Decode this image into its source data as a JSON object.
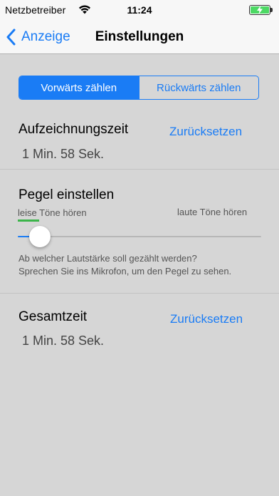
{
  "status": {
    "carrier": "Netzbetreiber",
    "time": "11:24",
    "battery_color": "#4cd964",
    "wifi_icon": "wifi-icon",
    "battery_icon": "battery-charging-icon"
  },
  "nav": {
    "back_label": "Anzeige",
    "title": "Einstellungen",
    "back_icon": "chevron-left-icon"
  },
  "colors": {
    "accent": "#1a7cf5",
    "level_indicator": "#3cb54a",
    "background": "#d6d6d6"
  },
  "segment": {
    "options": [
      "Vorwärts zählen",
      "Rückwärts zählen"
    ],
    "selected": "Vorwärts zählen"
  },
  "recording": {
    "title": "Aufzeichnungszeit",
    "reset_label": "Zurücksetzen",
    "value": "1 Min. 58 Sek."
  },
  "level": {
    "title": "Pegel einstellen",
    "min_label": "leise Töne hören",
    "max_label": "laute Töne hören",
    "slider_value": 0.05,
    "help_line1": "Ab welcher Lautstärke soll gezählt werden?",
    "help_line2": "Sprechen Sie ins Mikrofon, um den Pegel zu sehen."
  },
  "total": {
    "title": "Gesamtzeit",
    "reset_label": "Zurücksetzen",
    "value": "1 Min. 58 Sek."
  }
}
